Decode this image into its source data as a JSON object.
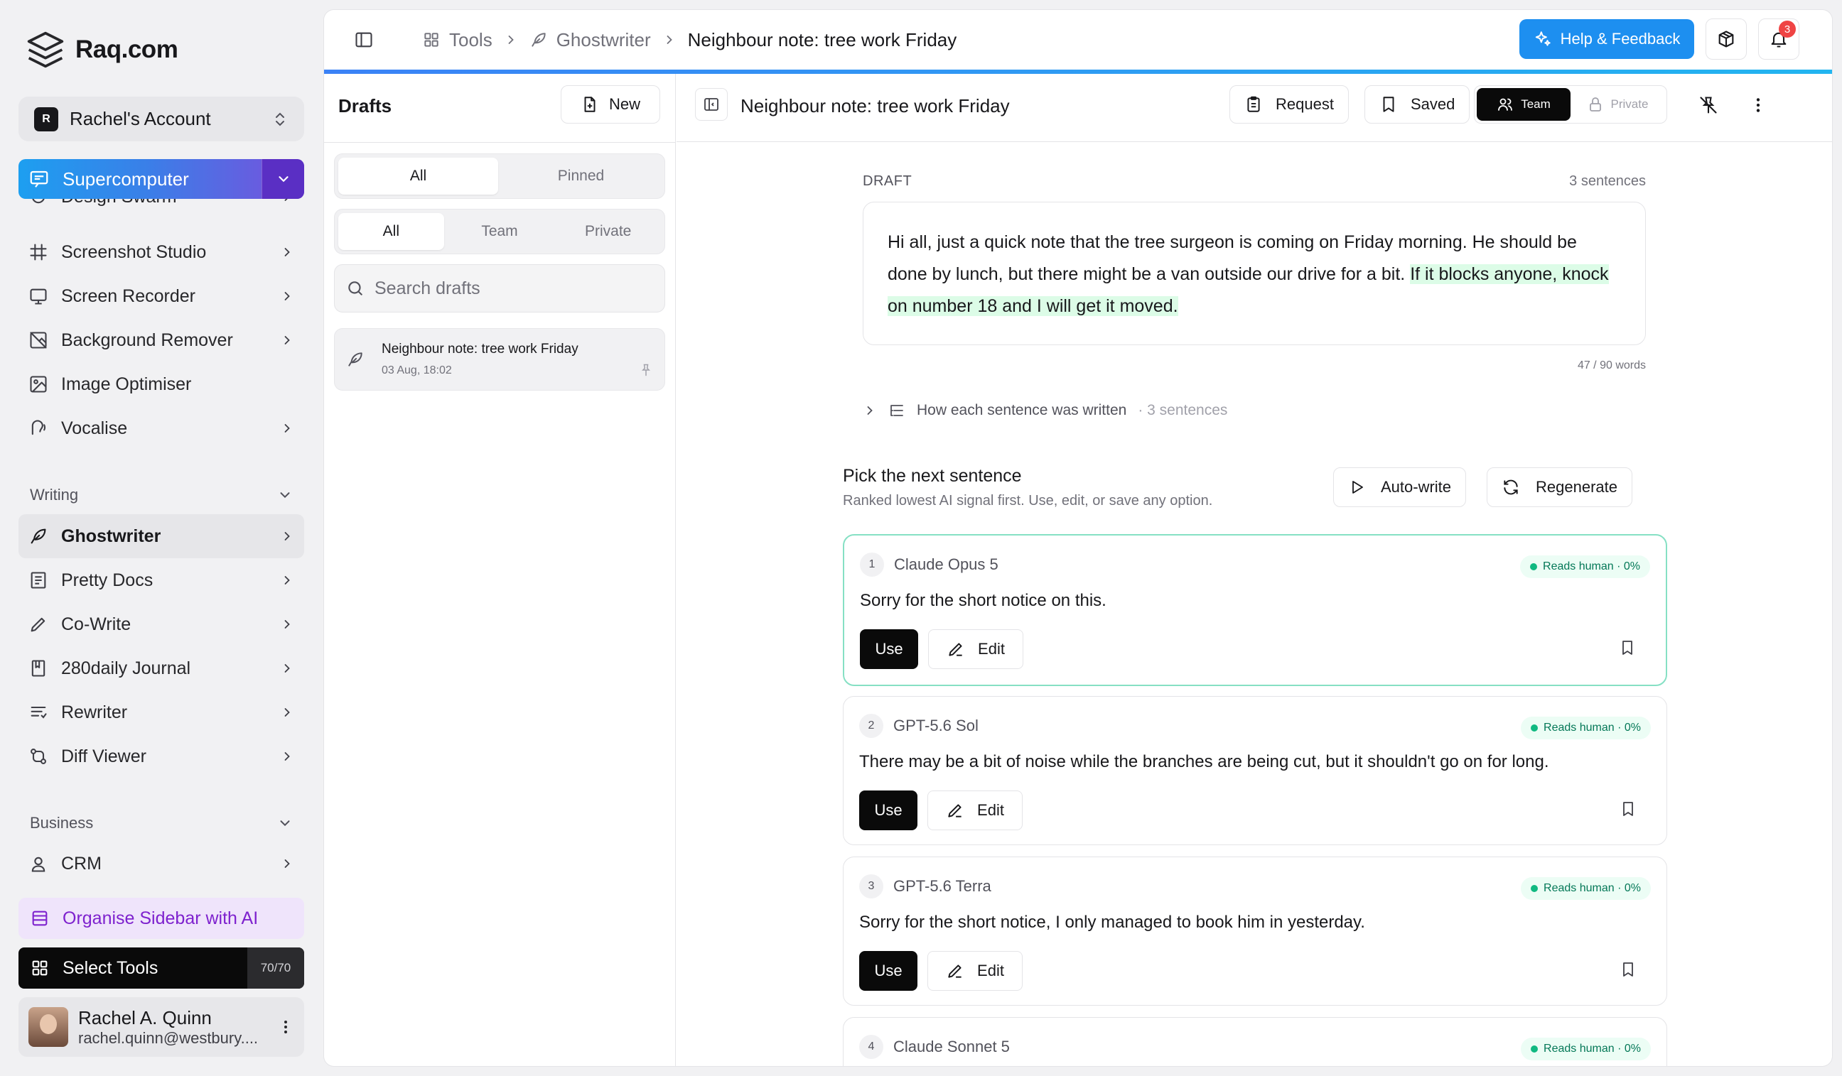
{
  "brand": {
    "name": "Raq.com"
  },
  "account": {
    "badge": "R",
    "name": "Rachel's Account"
  },
  "supercomputer": {
    "label": "Supercomputer"
  },
  "nav_partial": {
    "label": "Design Swarm"
  },
  "nav_tools": [
    {
      "label": "Screenshot Studio",
      "icon": "grid-hash-icon"
    },
    {
      "label": "Screen Recorder",
      "icon": "monitor-icon"
    },
    {
      "label": "Background Remover",
      "icon": "image-off-icon"
    },
    {
      "label": "Image Optimiser",
      "icon": "image-icon"
    },
    {
      "label": "Vocalise",
      "icon": "voice-icon"
    }
  ],
  "writing": {
    "heading": "Writing",
    "items": [
      {
        "label": "Ghostwriter",
        "icon": "feather-icon"
      },
      {
        "label": "Pretty Docs",
        "icon": "docs-icon"
      },
      {
        "label": "Co-Write",
        "icon": "pen-icon"
      },
      {
        "label": "280daily Journal",
        "icon": "journal-icon"
      },
      {
        "label": "Rewriter",
        "icon": "lines-icon"
      },
      {
        "label": "Diff Viewer",
        "icon": "diff-icon"
      }
    ]
  },
  "business": {
    "heading": "Business",
    "items": [
      {
        "label": "CRM",
        "icon": "contact-icon"
      }
    ]
  },
  "organise": {
    "label": "Organise Sidebar with AI"
  },
  "select_tools": {
    "label": "Select Tools",
    "count": "70/70"
  },
  "user": {
    "name": "Rachel A. Quinn",
    "email": "rachel.quinn@westbury...."
  },
  "breadcrumbs": {
    "tools": "Tools",
    "ghostwriter": "Ghostwriter",
    "current": "Neighbour note: tree work Friday"
  },
  "help": {
    "label": "Help & Feedback"
  },
  "notifications": {
    "count": "3"
  },
  "drafts": {
    "title": "Drafts",
    "new_label": "New",
    "filter1": [
      "All",
      "Pinned"
    ],
    "filter2": [
      "All",
      "Team",
      "Private"
    ],
    "search_placeholder": "Search drafts",
    "items": [
      {
        "title": "Neighbour note: tree work Friday",
        "date": "03 Aug, 18:02"
      }
    ]
  },
  "editor": {
    "title": "Neighbour note: tree work Friday",
    "request_label": "Request",
    "saved_label": "Saved",
    "team_label": "Team",
    "private_label": "Private",
    "draft_label": "DRAFT",
    "sentence_count": "3 sentences",
    "draft_text_plain": "Hi all, just a quick note that the tree surgeon is coming on Friday morning. He should be done by lunch, but there might be a van outside our drive for a bit.",
    "draft_text_highlight": "If it blocks anyone, knock on number 18 and I will get it moved.",
    "word_count": "47 / 90 words",
    "how_label": "How each sentence was written",
    "how_count": "· 3 sentences"
  },
  "pick": {
    "title": "Pick the next sentence",
    "subtitle": "Ranked lowest AI signal first. Use, edit, or save any option.",
    "autowrite_label": "Auto-write",
    "regenerate_label": "Regenerate",
    "use_label": "Use",
    "edit_label": "Edit",
    "options": [
      {
        "num": "1",
        "model": "Claude Opus 5",
        "badge": "Reads human · 0%",
        "sentence": "Sorry for the short notice on this."
      },
      {
        "num": "2",
        "model": "GPT-5.6 Sol",
        "badge": "Reads human · 0%",
        "sentence": "There may be a bit of noise while the branches are being cut, but it shouldn't go on for long."
      },
      {
        "num": "3",
        "model": "GPT-5.6 Terra",
        "badge": "Reads human · 0%",
        "sentence": "Sorry for the short notice, I only managed to book him in yesterday."
      },
      {
        "num": "4",
        "model": "Claude Sonnet 5",
        "badge": "Reads human · 0%",
        "sentence": ""
      }
    ]
  }
}
